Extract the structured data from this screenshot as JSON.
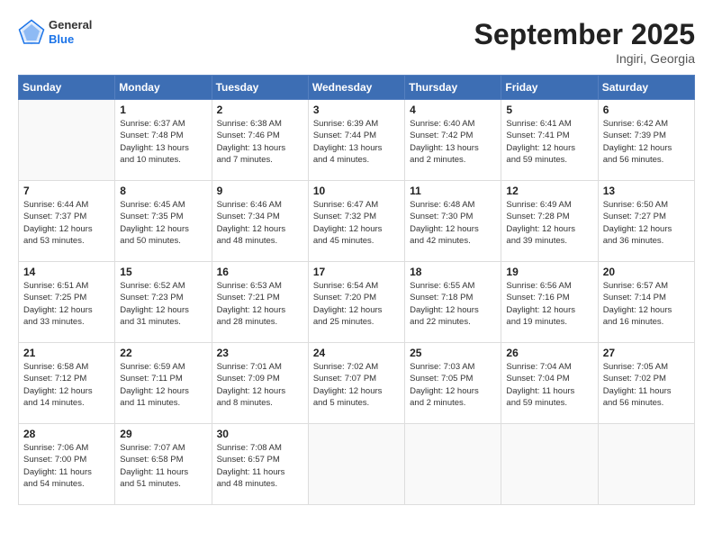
{
  "header": {
    "logo_general": "General",
    "logo_blue": "Blue",
    "month_title": "September 2025",
    "location": "Ingiri, Georgia"
  },
  "weekdays": [
    "Sunday",
    "Monday",
    "Tuesday",
    "Wednesday",
    "Thursday",
    "Friday",
    "Saturday"
  ],
  "weeks": [
    [
      {
        "day": "",
        "info": ""
      },
      {
        "day": "1",
        "info": "Sunrise: 6:37 AM\nSunset: 7:48 PM\nDaylight: 13 hours\nand 10 minutes."
      },
      {
        "day": "2",
        "info": "Sunrise: 6:38 AM\nSunset: 7:46 PM\nDaylight: 13 hours\nand 7 minutes."
      },
      {
        "day": "3",
        "info": "Sunrise: 6:39 AM\nSunset: 7:44 PM\nDaylight: 13 hours\nand 4 minutes."
      },
      {
        "day": "4",
        "info": "Sunrise: 6:40 AM\nSunset: 7:42 PM\nDaylight: 13 hours\nand 2 minutes."
      },
      {
        "day": "5",
        "info": "Sunrise: 6:41 AM\nSunset: 7:41 PM\nDaylight: 12 hours\nand 59 minutes."
      },
      {
        "day": "6",
        "info": "Sunrise: 6:42 AM\nSunset: 7:39 PM\nDaylight: 12 hours\nand 56 minutes."
      }
    ],
    [
      {
        "day": "7",
        "info": "Sunrise: 6:44 AM\nSunset: 7:37 PM\nDaylight: 12 hours\nand 53 minutes."
      },
      {
        "day": "8",
        "info": "Sunrise: 6:45 AM\nSunset: 7:35 PM\nDaylight: 12 hours\nand 50 minutes."
      },
      {
        "day": "9",
        "info": "Sunrise: 6:46 AM\nSunset: 7:34 PM\nDaylight: 12 hours\nand 48 minutes."
      },
      {
        "day": "10",
        "info": "Sunrise: 6:47 AM\nSunset: 7:32 PM\nDaylight: 12 hours\nand 45 minutes."
      },
      {
        "day": "11",
        "info": "Sunrise: 6:48 AM\nSunset: 7:30 PM\nDaylight: 12 hours\nand 42 minutes."
      },
      {
        "day": "12",
        "info": "Sunrise: 6:49 AM\nSunset: 7:28 PM\nDaylight: 12 hours\nand 39 minutes."
      },
      {
        "day": "13",
        "info": "Sunrise: 6:50 AM\nSunset: 7:27 PM\nDaylight: 12 hours\nand 36 minutes."
      }
    ],
    [
      {
        "day": "14",
        "info": "Sunrise: 6:51 AM\nSunset: 7:25 PM\nDaylight: 12 hours\nand 33 minutes."
      },
      {
        "day": "15",
        "info": "Sunrise: 6:52 AM\nSunset: 7:23 PM\nDaylight: 12 hours\nand 31 minutes."
      },
      {
        "day": "16",
        "info": "Sunrise: 6:53 AM\nSunset: 7:21 PM\nDaylight: 12 hours\nand 28 minutes."
      },
      {
        "day": "17",
        "info": "Sunrise: 6:54 AM\nSunset: 7:20 PM\nDaylight: 12 hours\nand 25 minutes."
      },
      {
        "day": "18",
        "info": "Sunrise: 6:55 AM\nSunset: 7:18 PM\nDaylight: 12 hours\nand 22 minutes."
      },
      {
        "day": "19",
        "info": "Sunrise: 6:56 AM\nSunset: 7:16 PM\nDaylight: 12 hours\nand 19 minutes."
      },
      {
        "day": "20",
        "info": "Sunrise: 6:57 AM\nSunset: 7:14 PM\nDaylight: 12 hours\nand 16 minutes."
      }
    ],
    [
      {
        "day": "21",
        "info": "Sunrise: 6:58 AM\nSunset: 7:12 PM\nDaylight: 12 hours\nand 14 minutes."
      },
      {
        "day": "22",
        "info": "Sunrise: 6:59 AM\nSunset: 7:11 PM\nDaylight: 12 hours\nand 11 minutes."
      },
      {
        "day": "23",
        "info": "Sunrise: 7:01 AM\nSunset: 7:09 PM\nDaylight: 12 hours\nand 8 minutes."
      },
      {
        "day": "24",
        "info": "Sunrise: 7:02 AM\nSunset: 7:07 PM\nDaylight: 12 hours\nand 5 minutes."
      },
      {
        "day": "25",
        "info": "Sunrise: 7:03 AM\nSunset: 7:05 PM\nDaylight: 12 hours\nand 2 minutes."
      },
      {
        "day": "26",
        "info": "Sunrise: 7:04 AM\nSunset: 7:04 PM\nDaylight: 11 hours\nand 59 minutes."
      },
      {
        "day": "27",
        "info": "Sunrise: 7:05 AM\nSunset: 7:02 PM\nDaylight: 11 hours\nand 56 minutes."
      }
    ],
    [
      {
        "day": "28",
        "info": "Sunrise: 7:06 AM\nSunset: 7:00 PM\nDaylight: 11 hours\nand 54 minutes."
      },
      {
        "day": "29",
        "info": "Sunrise: 7:07 AM\nSunset: 6:58 PM\nDaylight: 11 hours\nand 51 minutes."
      },
      {
        "day": "30",
        "info": "Sunrise: 7:08 AM\nSunset: 6:57 PM\nDaylight: 11 hours\nand 48 minutes."
      },
      {
        "day": "",
        "info": ""
      },
      {
        "day": "",
        "info": ""
      },
      {
        "day": "",
        "info": ""
      },
      {
        "day": "",
        "info": ""
      }
    ]
  ]
}
